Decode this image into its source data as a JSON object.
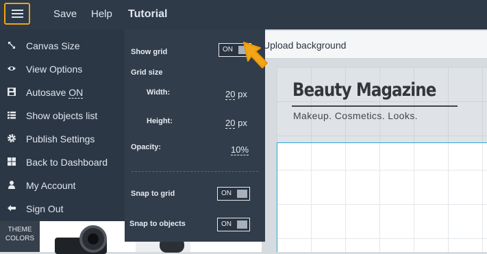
{
  "topbar": {
    "save_label": "Save",
    "help_label": "Help",
    "title": "Tutorial"
  },
  "toolbar": {
    "upload_label": "Upload background"
  },
  "canvas": {
    "magazine_title": "Beauty Magazine",
    "magazine_subtitle": "Makeup. Cosmetics. Looks."
  },
  "sidebar": {
    "items": [
      {
        "label": "Canvas Size",
        "icon": "resize-icon"
      },
      {
        "label": "View Options",
        "icon": "eye-icon"
      },
      {
        "label": "Autosave",
        "value": "ON",
        "icon": "save-icon"
      },
      {
        "label": "Show objects list",
        "icon": "list-icon"
      },
      {
        "label": "Publish Settings",
        "icon": "gear-icon"
      },
      {
        "label": "Back to Dashboard",
        "icon": "dashboard-icon"
      },
      {
        "label": "My Account",
        "icon": "user-icon"
      },
      {
        "label": "Sign Out",
        "icon": "sign-out-icon"
      }
    ],
    "theme_line1": "THEME",
    "theme_line2": "COLORS"
  },
  "grid_panel": {
    "show_grid_label": "Show grid",
    "show_grid_toggle": "ON",
    "grid_size_label": "Grid size",
    "width_label": "Width:",
    "width_value": "20",
    "width_unit": "px",
    "height_label": "Height:",
    "height_value": "20",
    "height_unit": "px",
    "opacity_label": "Opacity:",
    "opacity_value": "10%",
    "snap_grid_label": "Snap to grid",
    "snap_grid_toggle": "ON",
    "snap_objects_label": "Snap to objects",
    "snap_objects_toggle": "ON"
  },
  "colors": {
    "accent": "#f2a516",
    "topbar": "#2f3a48",
    "sidebar": "#2c3745",
    "selection": "#29a3dc"
  }
}
